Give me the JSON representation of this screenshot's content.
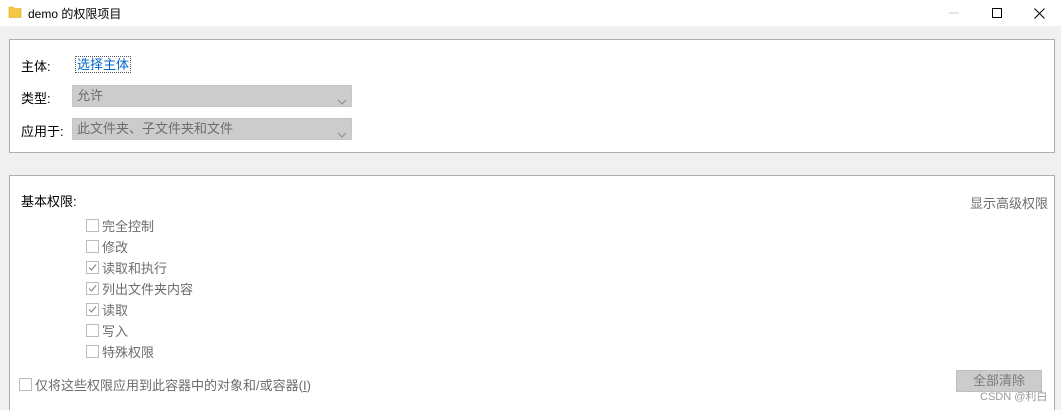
{
  "window": {
    "title": "demo 的权限项目",
    "folder_icon": "folder-icon"
  },
  "principal": {
    "label": "主体:",
    "select_link": "选择主体"
  },
  "type": {
    "label": "类型:",
    "value": "允许"
  },
  "applies_to": {
    "label": "应用于:",
    "value": "此文件夹、子文件夹和文件"
  },
  "basic_permissions": {
    "heading": "基本权限:",
    "show_advanced": "显示高级权限",
    "items": [
      {
        "label": "完全控制",
        "checked": false
      },
      {
        "label": "修改",
        "checked": false
      },
      {
        "label": "读取和执行",
        "checked": true
      },
      {
        "label": "列出文件夹内容",
        "checked": true
      },
      {
        "label": "读取",
        "checked": true
      },
      {
        "label": "写入",
        "checked": false
      },
      {
        "label": "特殊权限",
        "checked": false
      }
    ]
  },
  "apply_only": {
    "label_main": "仅将这些权限应用到此容器中的对象和/或容器(",
    "label_key": "I",
    "label_end": ")",
    "checked": false
  },
  "clear_all": "全部清除",
  "watermark": "CSDN @利白",
  "colors": {
    "link": "#0066cc",
    "disabled_text": "#6d6d6d",
    "disabled_bg": "#cccccc",
    "folder": "#f5c842"
  }
}
